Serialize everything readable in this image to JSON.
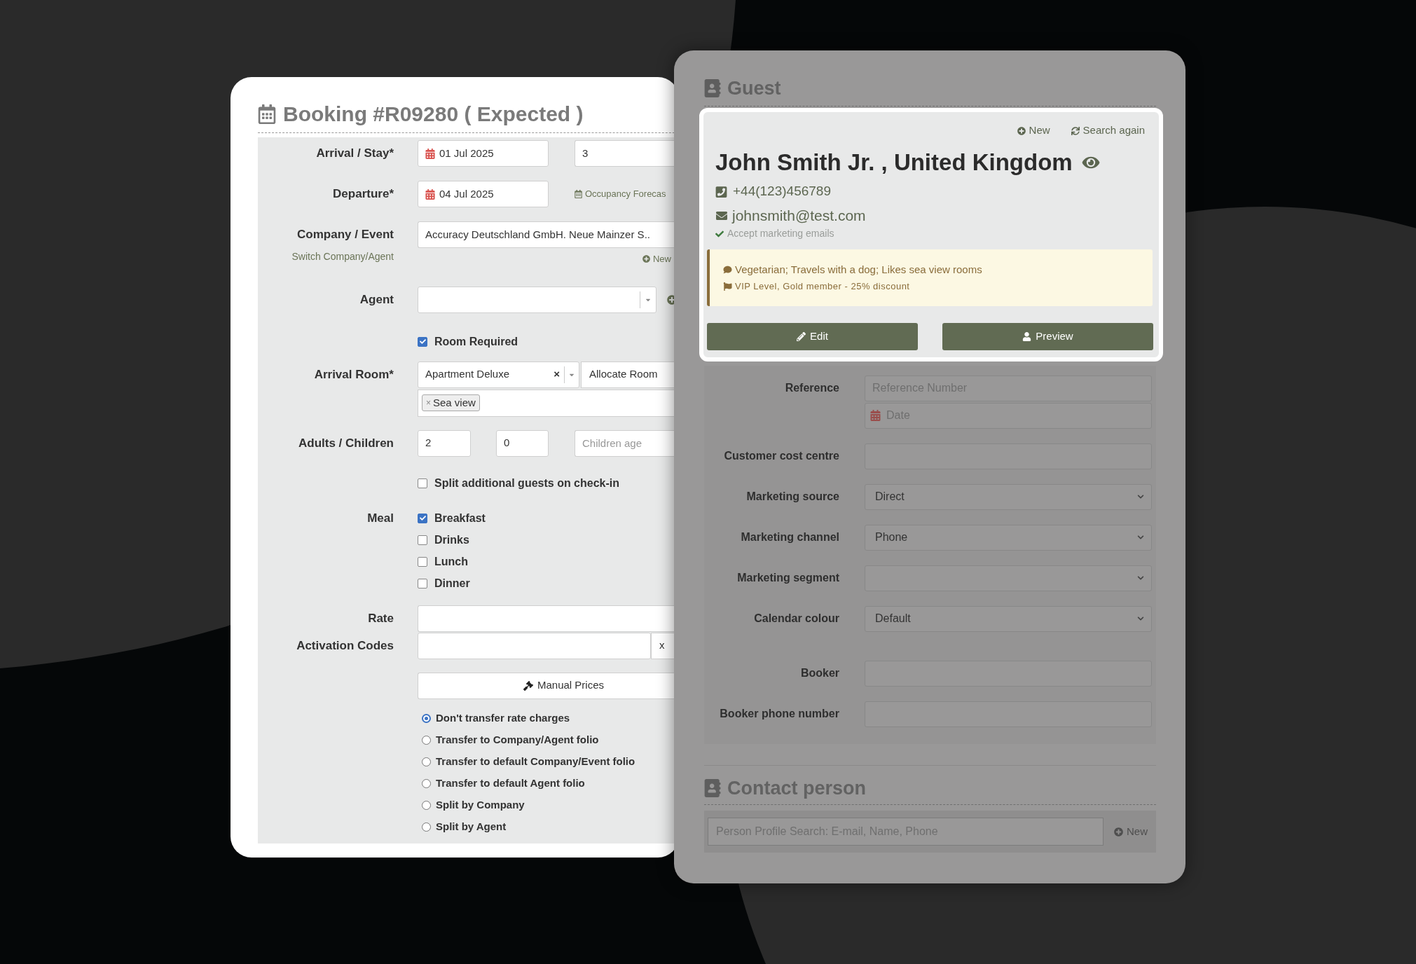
{
  "booking": {
    "title": "Booking #R09280 ( Expected )",
    "arrival": {
      "label": "Arrival / Stay*",
      "date": "01 Jul 2025",
      "nights": "3"
    },
    "departure": {
      "label": "Departure*",
      "date": "04 Jul 2025",
      "link": "Occupancy Forecas"
    },
    "company": {
      "label": "Company / Event",
      "sublabel": "Switch Company/Agent",
      "value": "Accuracy Deutschland GmbH. Neue Mainzer S..",
      "new": "New"
    },
    "agent": {
      "label": "Agent"
    },
    "room_required": {
      "label": "Room Required",
      "checked": true
    },
    "arrival_room": {
      "label": "Arrival Room*",
      "value": "Apartment Deluxe",
      "clear": "×",
      "allocate": "Allocate Room",
      "tags": [
        {
          "label": "Sea view",
          "remove": "×"
        }
      ]
    },
    "adults_children": {
      "label": "Adults / Children",
      "adults": "2",
      "children": "0",
      "age_placeholder": "Children age"
    },
    "split_guests": {
      "label": "Split additional guests on check-in",
      "checked": false
    },
    "meal": {
      "label": "Meal",
      "options": [
        {
          "label": "Breakfast",
          "checked": true
        },
        {
          "label": "Drinks",
          "checked": false
        },
        {
          "label": "Lunch",
          "checked": false
        },
        {
          "label": "Dinner",
          "checked": false
        }
      ]
    },
    "rate": {
      "label": "Rate"
    },
    "activation_codes": {
      "label": "Activation Codes",
      "clear": "x"
    },
    "manual_prices": "Manual Prices",
    "transfer_options": [
      {
        "label": "Don't transfer rate charges",
        "selected": true
      },
      {
        "label": "Transfer to Company/Agent folio",
        "selected": false
      },
      {
        "label": "Transfer to default Company/Event folio",
        "selected": false
      },
      {
        "label": "Transfer to default Agent folio",
        "selected": false
      },
      {
        "label": "Split by Company",
        "selected": false
      },
      {
        "label": "Split by Agent",
        "selected": false
      }
    ]
  },
  "guest": {
    "title": "Guest",
    "new": "New",
    "search_again": "Search again",
    "name": "John Smith Jr. , United Kingdom",
    "phone": "+44(123)456789",
    "email": "johnsmith@test.com",
    "marketing_emails": {
      "label": "Accept marketing emails",
      "checked": true
    },
    "notes": [
      {
        "kind": "comment",
        "text": "Vegetarian; Travels with a dog; Likes sea view rooms"
      },
      {
        "kind": "flag",
        "text": "VIP Level, Gold member - 25% discount"
      }
    ],
    "buttons": [
      {
        "kind": "edit",
        "label": "Edit"
      },
      {
        "kind": "preview",
        "label": "Preview"
      }
    ],
    "fields": [
      {
        "kind": "text",
        "label": "Reference",
        "placeholder": "Reference Number"
      },
      {
        "kind": "date",
        "placeholder": "Date"
      },
      {
        "kind": "text",
        "label": "Customer cost centre"
      },
      {
        "kind": "select",
        "label": "Marketing source",
        "value": "Direct"
      },
      {
        "kind": "select",
        "label": "Marketing channel",
        "value": "Phone"
      },
      {
        "kind": "select",
        "label": "Marketing segment"
      },
      {
        "kind": "select",
        "label": "Calendar colour",
        "value": "Default"
      }
    ],
    "booker_fields": [
      {
        "kind": "text",
        "label": "Booker"
      },
      {
        "kind": "text",
        "label": "Booker phone number"
      }
    ]
  },
  "contact_person": {
    "title": "Contact person",
    "search_placeholder": "Person Profile Search: E-mail, Name, Phone",
    "new": "New"
  }
}
